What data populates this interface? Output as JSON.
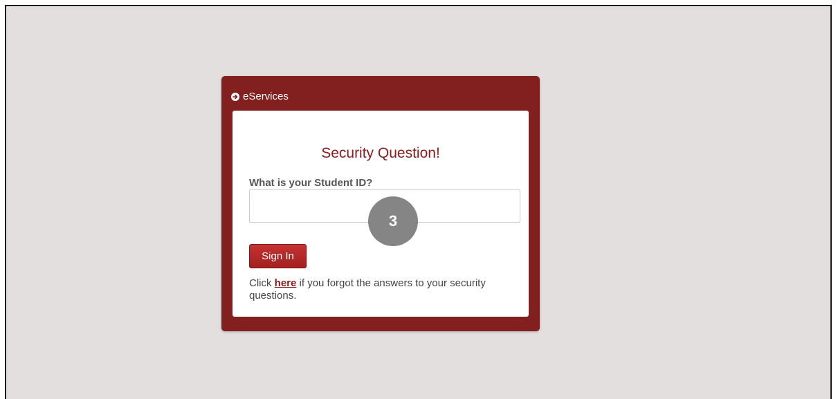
{
  "panel": {
    "header_label": "eServices",
    "header_icon": "arrow-circle-right-icon"
  },
  "form": {
    "title": "Security Question!",
    "question_label": "What is your Student ID?",
    "answer_value": "",
    "answer_placeholder": "",
    "submit_label": "Sign In",
    "help_prefix": "Click",
    "help_link": "here",
    "help_suffix": "if you forgot the answers to your security questions."
  },
  "annotation": {
    "step_number": "3"
  },
  "colors": {
    "panel_bg": "#821f1f",
    "accent": "#8c1a1a",
    "page_bg": "#e3dfde",
    "badge_bg": "#858585"
  }
}
